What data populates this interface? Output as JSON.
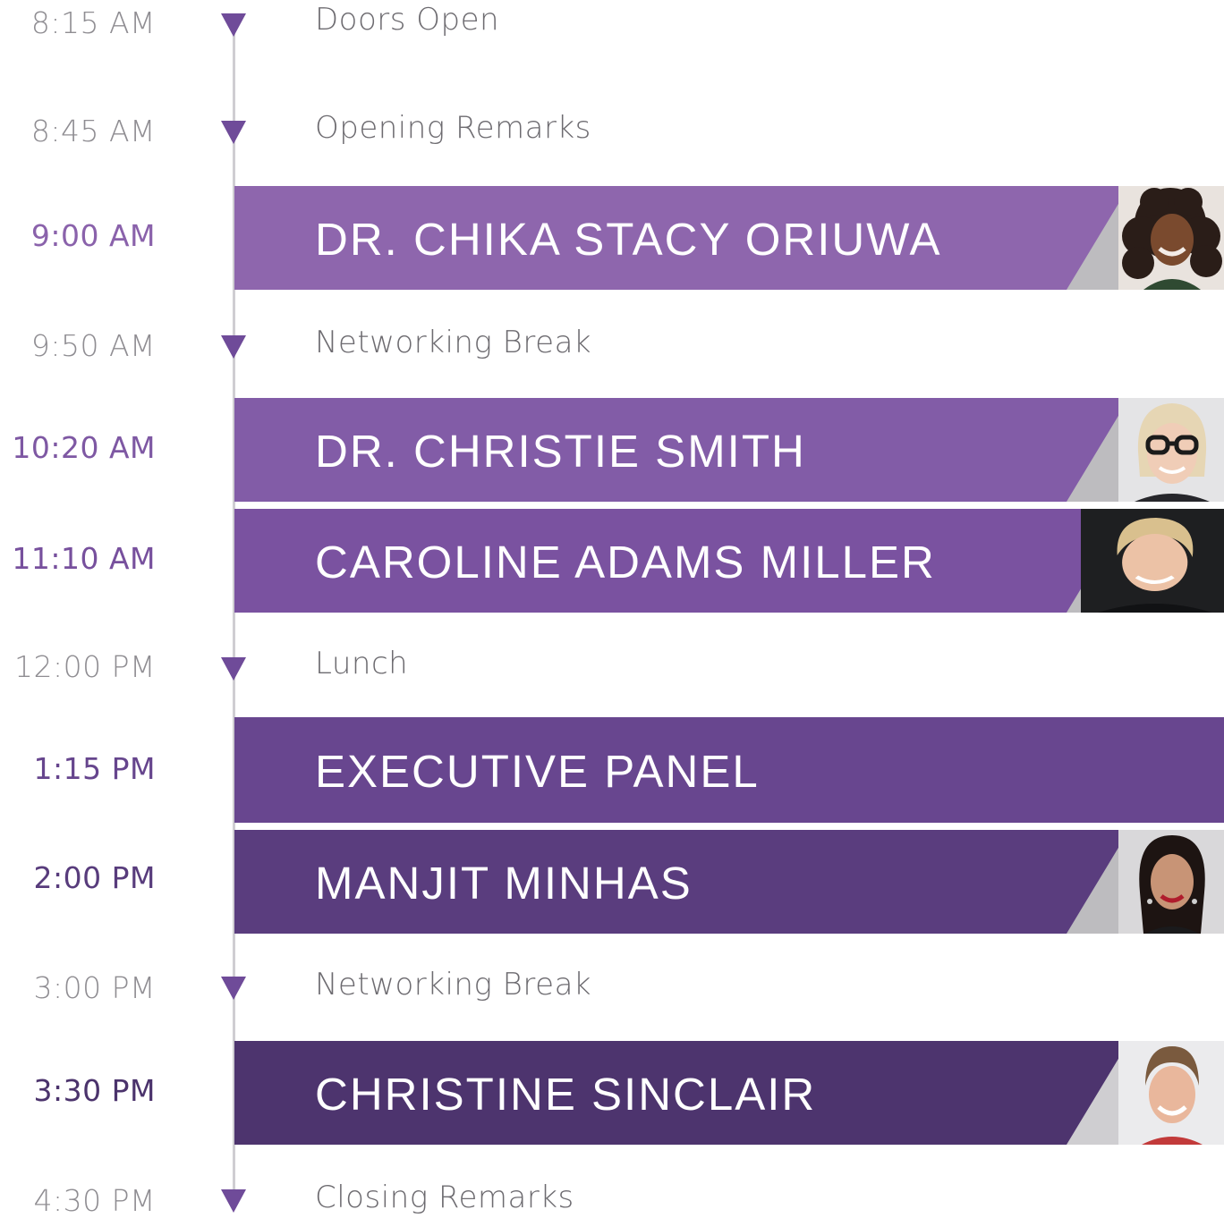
{
  "schedule": {
    "events": [
      {
        "time": "8:15 AM",
        "label": "Doors Open",
        "kind": "minor"
      },
      {
        "time": "8:45 AM",
        "label": "Opening Remarks",
        "kind": "minor"
      },
      {
        "time": "9:00 AM",
        "label": "DR. CHIKA STACY ORIUWA",
        "kind": "speaker",
        "color": "#8e66ad",
        "time_color": "#8a62ab",
        "portrait": "portrait-dark-curly-hair"
      },
      {
        "time": "9:50 AM",
        "label": "Networking Break",
        "kind": "minor"
      },
      {
        "time": "10:20 AM",
        "label": "DR. CHRISTIE SMITH",
        "kind": "speaker",
        "color": "#825ca7",
        "time_color": "#7e58a3",
        "portrait": "portrait-blonde-glasses"
      },
      {
        "time": "11:10 AM",
        "label": "CAROLINE ADAMS MILLER",
        "kind": "speaker",
        "color": "#7a52a0",
        "time_color": "#77509d",
        "portrait": "portrait-short-blonde"
      },
      {
        "time": "12:00 PM",
        "label": "Lunch",
        "kind": "minor"
      },
      {
        "time": "1:15 PM",
        "label": "EXECUTIVE PANEL",
        "kind": "panel",
        "color": "#68468f",
        "time_color": "#66458d"
      },
      {
        "time": "2:00 PM",
        "label": "MANJIT MINHAS",
        "kind": "speaker",
        "color": "#5a3d7e",
        "time_color": "#583c7c",
        "portrait": "portrait-dark-hair"
      },
      {
        "time": "3:00 PM",
        "label": "Networking Break",
        "kind": "minor"
      },
      {
        "time": "3:30 PM",
        "label": "CHRISTINE SINCLAIR",
        "kind": "speaker",
        "color": "#4d346e",
        "time_color": "#4b336c",
        "portrait": "portrait-pulled-back-hair"
      },
      {
        "time": "4:30 PM",
        "label": "Closing Remarks",
        "kind": "minor"
      }
    ],
    "colors": {
      "timeline": "#cfcdd2",
      "marker": "#6f4b99",
      "minor_text": "#6d6b70",
      "minor_time": "#8f8d92",
      "photo_backdrop": "#bdbcbf"
    }
  }
}
